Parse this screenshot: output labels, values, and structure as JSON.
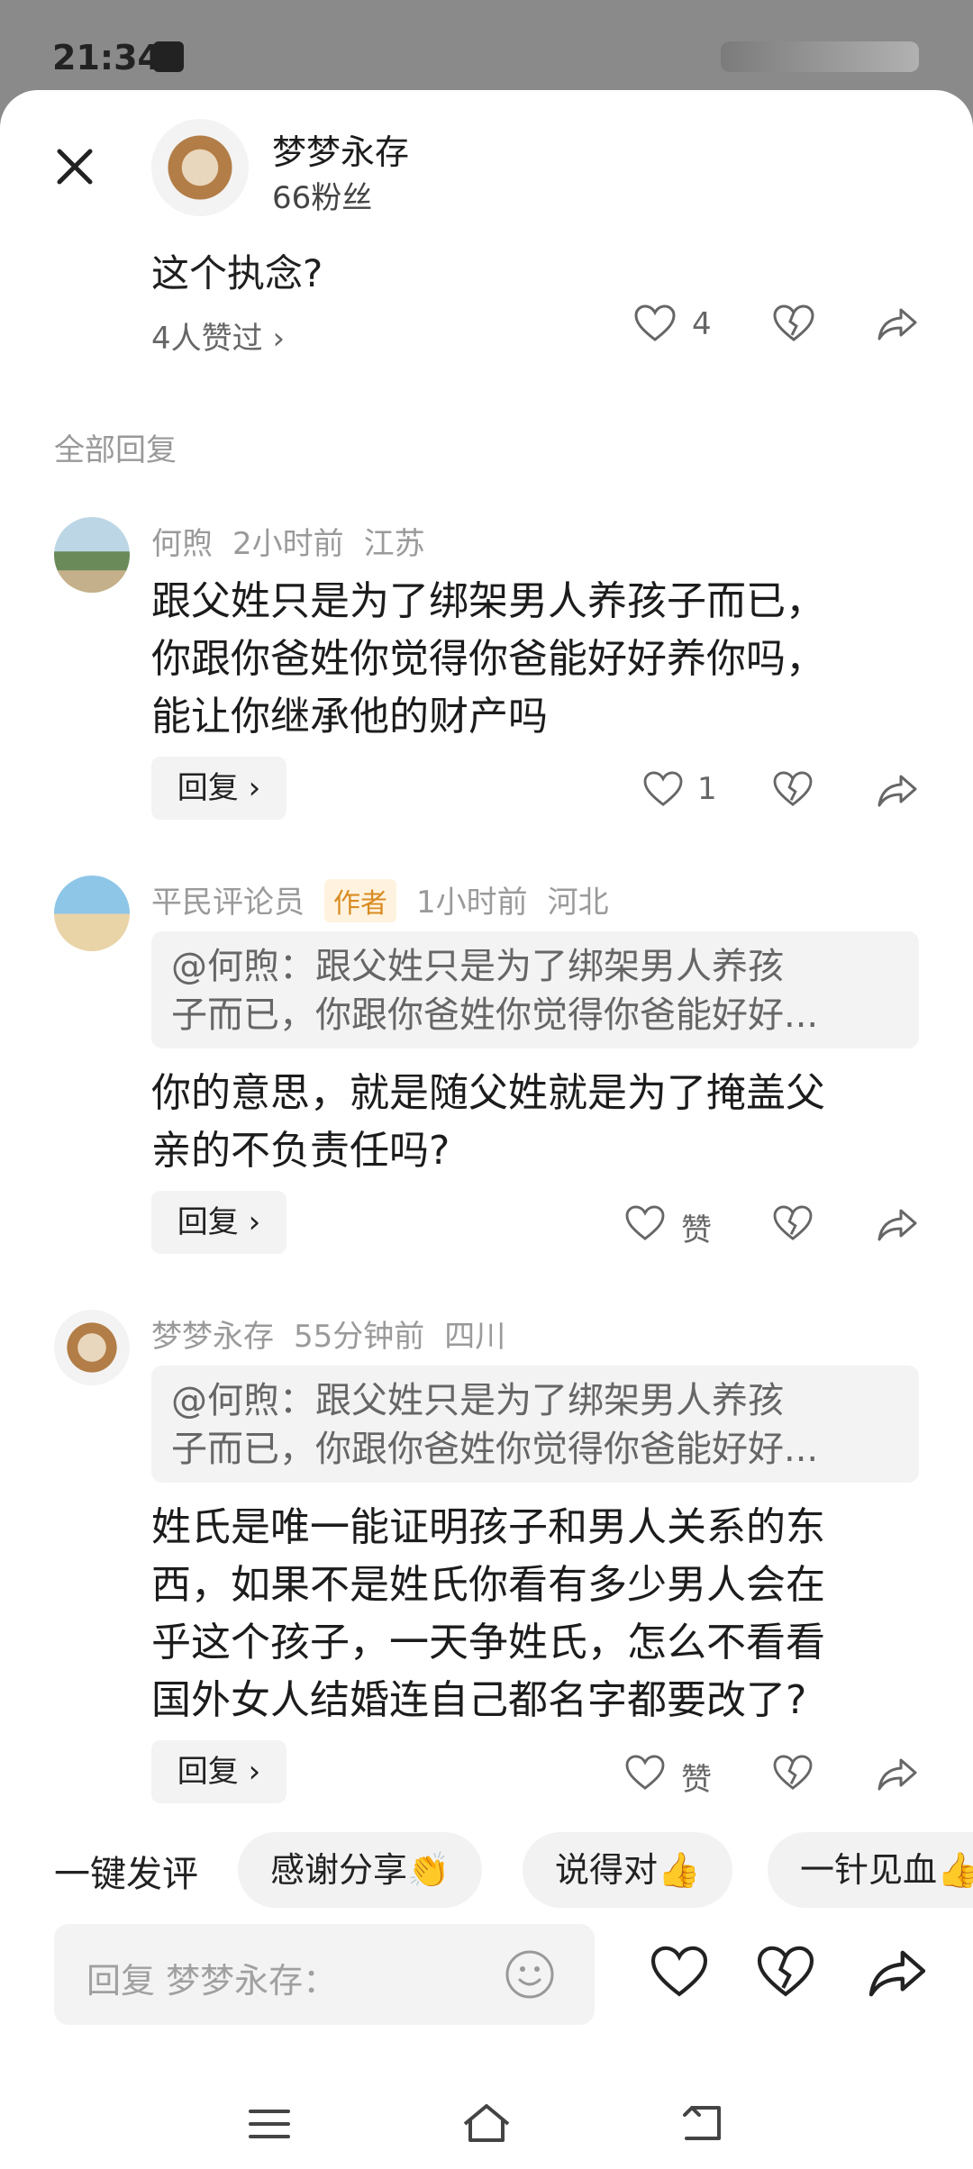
{
  "status": {
    "time": "21:34"
  },
  "header": {
    "author_name": "梦梦永存",
    "fans": "66粉丝"
  },
  "post": {
    "text_tail": "这个执念?",
    "liked_by": "4人赞过 ›",
    "like_count": "4"
  },
  "section_title": "全部回复",
  "comments": [
    {
      "name": "何煦",
      "time": "2小时前",
      "location": "江苏",
      "body_lines": [
        "跟父姓只是为了绑架男人养孩子而已，",
        "你跟你爸姓你觉得你爸能好好养你吗，",
        "能让你继承他的财产吗"
      ],
      "reply_label": "回复 ›",
      "like_count": "1"
    },
    {
      "name": "平民评论员",
      "badge": "作者",
      "time": "1小时前",
      "location": "河北",
      "quote_line1": "@何煦：跟父姓只是为了绑架男人养孩",
      "quote_line2": "子而已，你跟你爸姓你觉得你爸能好好...",
      "body_lines": [
        "你的意思，就是随父姓就是为了掩盖父",
        "亲的不负责任吗?"
      ],
      "reply_label": "回复 ›",
      "like_label": "赞"
    },
    {
      "name": "梦梦永存",
      "time": "55分钟前",
      "location": "四川",
      "quote_line1": "@何煦：跟父姓只是为了绑架男人养孩",
      "quote_line2": "子而已，你跟你爸姓你觉得你爸能好好...",
      "body_lines": [
        "姓氏是唯一能证明孩子和男人关系的东",
        "西，如果不是姓氏你看有多少男人会在",
        "乎这个孩子，一天争姓氏，怎么不看看",
        "国外女人结婚连自己都名字都要改了?"
      ],
      "reply_label": "回复 ›",
      "like_label": "赞"
    }
  ],
  "quick_comment": {
    "label": "一键发评",
    "chips": [
      "感谢分享👏",
      "说得对👍",
      "一针见血👍"
    ]
  },
  "input": {
    "placeholder": "回复 梦梦永存："
  },
  "colors": {
    "accent_badge": "#d98b21",
    "badge_bg": "#fff3df",
    "chip_bg": "#f2f2f2"
  }
}
